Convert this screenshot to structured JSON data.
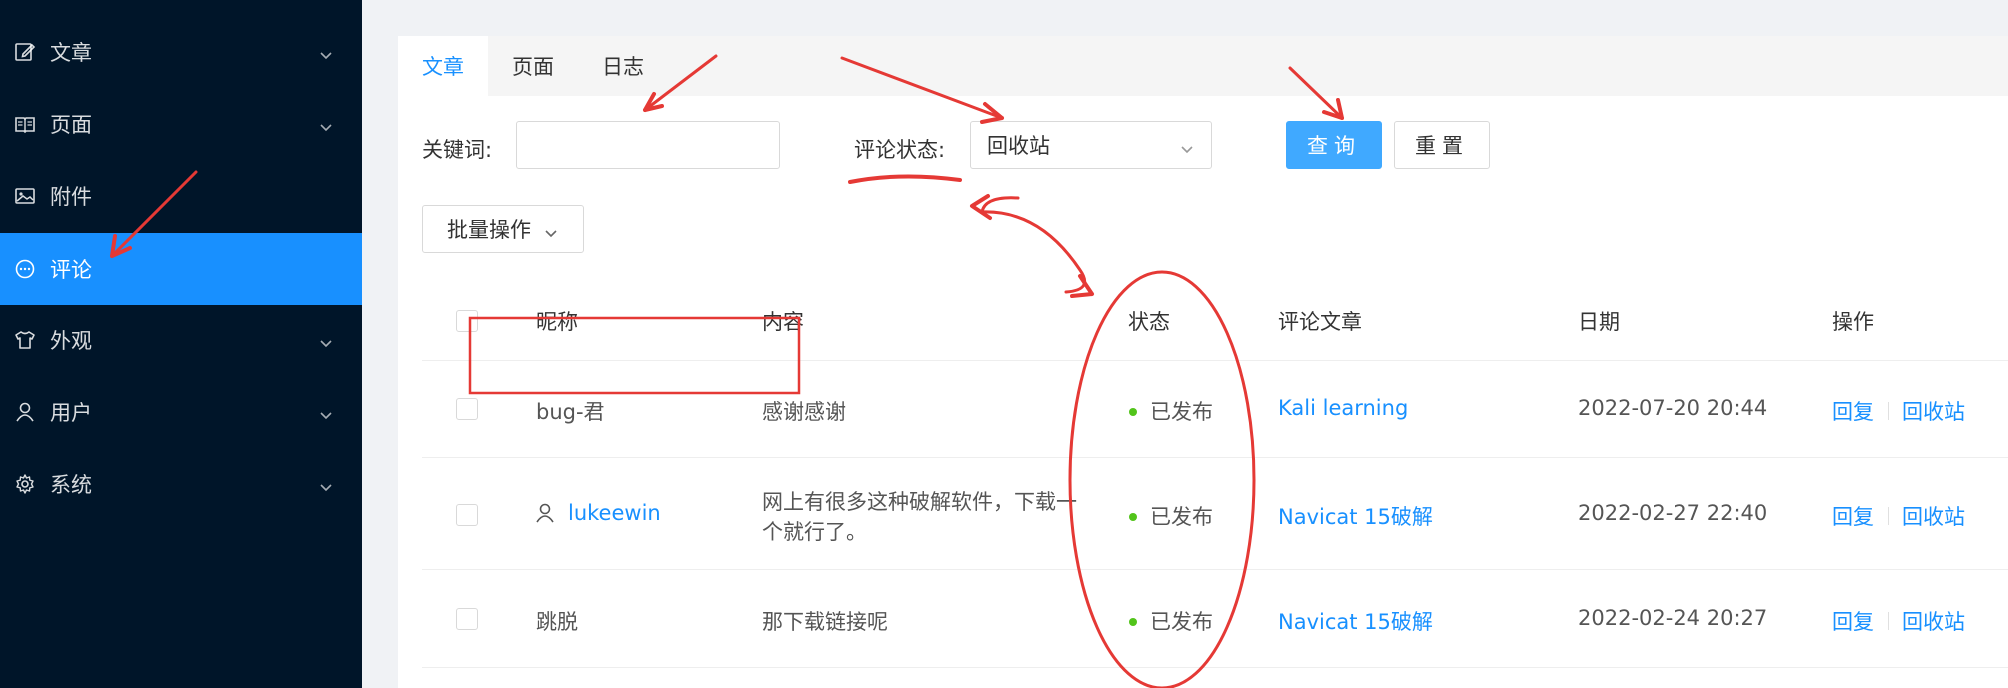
{
  "sidebar": {
    "items": [
      {
        "label": "文章",
        "icon": "edit-icon",
        "has_children": true
      },
      {
        "label": "页面",
        "icon": "book-icon",
        "has_children": true
      },
      {
        "label": "附件",
        "icon": "image-icon",
        "has_children": false
      },
      {
        "label": "评论",
        "icon": "comment-icon",
        "has_children": false,
        "active": true
      },
      {
        "label": "外观",
        "icon": "shirt-icon",
        "has_children": true
      },
      {
        "label": "用户",
        "icon": "user-icon",
        "has_children": true
      },
      {
        "label": "系统",
        "icon": "gear-icon",
        "has_children": true
      }
    ]
  },
  "tabs": [
    {
      "label": "文章",
      "active": true
    },
    {
      "label": "页面",
      "active": false
    },
    {
      "label": "日志",
      "active": false
    }
  ],
  "filters": {
    "keyword_label": "关键词:",
    "keyword_value": "",
    "status_label": "评论状态:",
    "status_value": "回收站",
    "query_button": "查询",
    "reset_button": "重置"
  },
  "batch": {
    "label": "批量操作"
  },
  "table": {
    "headers": {
      "nickname": "昵称",
      "content": "内容",
      "status": "状态",
      "post": "评论文章",
      "date": "日期",
      "actions": "操作"
    },
    "rows": [
      {
        "nickname": "bug-君",
        "content_line1": "感谢感谢",
        "content_line2": "",
        "status": "已发布",
        "post": "Kali learning",
        "date": "2022-07-20 20:44",
        "reply": "回复",
        "trash": "回收站"
      },
      {
        "nickname": "lukeewin",
        "content_line1": "网上有很多这种破解软件，下载一",
        "content_line2": "个就行了。",
        "status": "已发布",
        "post": "Navicat 15破解",
        "date": "2022-02-27 22:40",
        "reply": "回复",
        "trash": "回收站"
      },
      {
        "nickname": "跳脱",
        "content_line1": "那下载链接呢",
        "content_line2": "",
        "status": "已发布",
        "post": "Navicat 15破解",
        "date": "2022-02-24 20:27",
        "reply": "回复",
        "trash": "回收站"
      }
    ]
  },
  "colors": {
    "sidebar_bg": "#001529",
    "active_bg": "#1890ff",
    "link": "#1890ff",
    "published_dot": "#52c41a",
    "annotation_red": "#e53935"
  }
}
